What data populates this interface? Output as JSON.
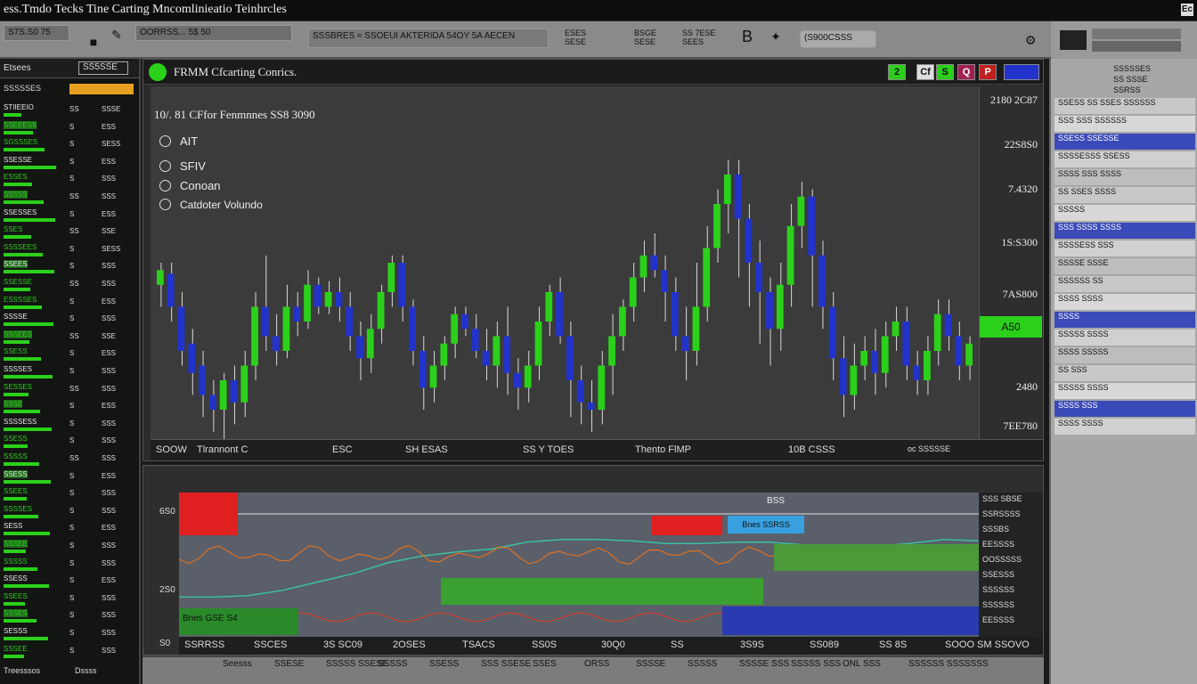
{
  "window": {
    "title": "ess.Tmdo Tecks Tine Carting Mncomlinieatio Teinhrcles",
    "corner_label": "Ec"
  },
  "toolbar": {
    "left_box": "S7S.S0 75",
    "search_box": "OORRSS... 5$ 50",
    "ticker_strip": "SSSBRES ≈ SSOEUI AKTERIDA 54OY  5A AECEN",
    "mid_a": "ESES\nSESE",
    "mid_b": "BSGE\nSESE",
    "mid_c": "SS 7ESE\nSEES",
    "dropdown": "(S900CSSS"
  },
  "left_panel": {
    "header_label": "Etsees",
    "header_box": "SS5SSE",
    "row2_label": "SSSSSES",
    "rows": [
      {
        "name": "STIIEEIO",
        "val": "SS",
        "chg": "SSSE"
      },
      {
        "name": "SSEEESS",
        "val": "S",
        "chg": "ESS"
      },
      {
        "name": "SGSSSES",
        "val": "S",
        "chg": "SESS"
      },
      {
        "name": "SSESSE",
        "val": "S",
        "chg": "ESS"
      },
      {
        "name": "ESSES",
        "val": "S",
        "chg": "SSS"
      },
      {
        "name": "SSSSS",
        "val": "SS",
        "chg": "SSS"
      },
      {
        "name": "SSESSES",
        "val": "S",
        "chg": "ESS"
      },
      {
        "name": "SSES",
        "val": "SS",
        "chg": "SSE"
      },
      {
        "name": "SSSSEES",
        "val": "S",
        "chg": "SESS"
      },
      {
        "name": "SSEES",
        "val": "S",
        "chg": "SSS"
      },
      {
        "name": "SSESSE",
        "val": "SS",
        "chg": "SSS"
      },
      {
        "name": "ESSSSES",
        "val": "S",
        "chg": "ESS"
      },
      {
        "name": "SSSSE",
        "val": "S",
        "chg": "SSS"
      },
      {
        "name": "SSSEES",
        "val": "SS",
        "chg": "SSE"
      },
      {
        "name": "SSESS",
        "val": "S",
        "chg": "ESS"
      },
      {
        "name": "SSSSES",
        "val": "S",
        "chg": "SSS"
      },
      {
        "name": "SESSES",
        "val": "SS",
        "chg": "SSS"
      },
      {
        "name": "SSSE",
        "val": "S",
        "chg": "ESS"
      },
      {
        "name": "SSSSESS",
        "val": "S",
        "chg": "SSS"
      },
      {
        "name": "SSESS",
        "val": "S",
        "chg": "SSS"
      },
      {
        "name": "SSSSS",
        "val": "SS",
        "chg": "SSS"
      },
      {
        "name": "SSESS",
        "val": "S",
        "chg": "ESS"
      },
      {
        "name": "SSEES",
        "val": "S",
        "chg": "SSS"
      },
      {
        "name": "SSSSES",
        "val": "S",
        "chg": "SSS"
      },
      {
        "name": "SESS",
        "val": "S",
        "chg": "ESS"
      },
      {
        "name": "SSSEE",
        "val": "S",
        "chg": "SSS"
      },
      {
        "name": "SSSSS",
        "val": "S",
        "chg": "SSS"
      },
      {
        "name": "SSESS",
        "val": "S",
        "chg": "ESS"
      },
      {
        "name": "SSEES",
        "val": "S",
        "chg": "SSS"
      },
      {
        "name": "SSSES",
        "val": "S",
        "chg": "SSS"
      },
      {
        "name": "SESSS",
        "val": "S",
        "chg": "SSS"
      },
      {
        "name": "SSSEE",
        "val": "S",
        "chg": "SSS"
      }
    ],
    "footer_label": "Treesssos",
    "footer_label2": "Dssss"
  },
  "chart": {
    "header_title": "FRMM Cfcarting Conrics.",
    "summary": "10/. 81 CFfor  Fenmnnes  SS8  3090",
    "legend": [
      "AIT",
      "SFIV",
      "Conoan",
      "Catdoter Volundo"
    ],
    "price_labels": [
      "2180 2C87",
      "22S8S0",
      "7.4320",
      "1S:S300",
      "7AS800",
      "2480",
      "7EE780"
    ],
    "price_highlight": "A50",
    "time_labels": [
      "SOOW",
      "Tlrannont C",
      "ESC",
      "SH ESAS",
      "SS Y  TOES",
      "Thento FlMP",
      "10B CSSS",
      "oc SSSSSE"
    ],
    "header_buttons": [
      "2",
      "Cf",
      "S",
      "Q",
      "P"
    ]
  },
  "chart_data": {
    "type": "candlestick",
    "title": "",
    "y_axis_labels": [
      "2180 2C87",
      "22S8S0",
      "7.4320",
      "1S:S300",
      "7AS800",
      "2480",
      "7EE780"
    ],
    "x_axis_labels": [
      "SOOW",
      "Tlrannont C",
      "ESC",
      "SH ESAS",
      "SS Y  TOES",
      "Thento FlMP",
      "10B CSSS"
    ],
    "series": [
      {
        "name": "AIT",
        "color": "#2bd01a"
      },
      {
        "name": "SFIV",
        "color": "#2233cc"
      }
    ],
    "candles": [
      {
        "o": 270,
        "c": 250,
        "h": 240,
        "l": 300
      },
      {
        "o": 255,
        "c": 300,
        "h": 240,
        "l": 320
      },
      {
        "o": 300,
        "c": 360,
        "h": 280,
        "l": 380
      },
      {
        "o": 350,
        "c": 390,
        "h": 330,
        "l": 420
      },
      {
        "o": 380,
        "c": 420,
        "h": 360,
        "l": 450
      },
      {
        "o": 420,
        "c": 440,
        "h": 400,
        "l": 470
      },
      {
        "o": 440,
        "c": 400,
        "h": 390,
        "l": 480
      },
      {
        "o": 400,
        "c": 430,
        "h": 380,
        "l": 460
      },
      {
        "o": 430,
        "c": 380,
        "h": 360,
        "l": 450
      },
      {
        "o": 380,
        "c": 300,
        "h": 280,
        "l": 400
      },
      {
        "o": 300,
        "c": 340,
        "h": 230,
        "l": 360
      },
      {
        "o": 340,
        "c": 360,
        "h": 310,
        "l": 380
      },
      {
        "o": 360,
        "c": 300,
        "h": 270,
        "l": 370
      },
      {
        "o": 300,
        "c": 320,
        "h": 280,
        "l": 340
      },
      {
        "o": 320,
        "c": 270,
        "h": 250,
        "l": 330
      },
      {
        "o": 270,
        "c": 300,
        "h": 260,
        "l": 310
      },
      {
        "o": 300,
        "c": 280,
        "h": 265,
        "l": 310
      },
      {
        "o": 280,
        "c": 300,
        "h": 260,
        "l": 320
      },
      {
        "o": 300,
        "c": 340,
        "h": 280,
        "l": 360
      },
      {
        "o": 340,
        "c": 370,
        "h": 320,
        "l": 400
      },
      {
        "o": 370,
        "c": 330,
        "h": 310,
        "l": 390
      },
      {
        "o": 330,
        "c": 280,
        "h": 270,
        "l": 350
      },
      {
        "o": 280,
        "c": 240,
        "h": 230,
        "l": 300
      },
      {
        "o": 240,
        "c": 300,
        "h": 230,
        "l": 320
      },
      {
        "o": 300,
        "c": 360,
        "h": 290,
        "l": 380
      },
      {
        "o": 360,
        "c": 410,
        "h": 340,
        "l": 440
      },
      {
        "o": 410,
        "c": 380,
        "h": 360,
        "l": 430
      },
      {
        "o": 380,
        "c": 350,
        "h": 340,
        "l": 400
      },
      {
        "o": 350,
        "c": 310,
        "h": 300,
        "l": 370
      },
      {
        "o": 310,
        "c": 330,
        "h": 300,
        "l": 340
      },
      {
        "o": 330,
        "c": 360,
        "h": 310,
        "l": 370
      },
      {
        "o": 360,
        "c": 380,
        "h": 330,
        "l": 400
      },
      {
        "o": 380,
        "c": 340,
        "h": 320,
        "l": 410
      },
      {
        "o": 340,
        "c": 390,
        "h": 300,
        "l": 420
      },
      {
        "o": 390,
        "c": 410,
        "h": 370,
        "l": 440
      },
      {
        "o": 410,
        "c": 380,
        "h": 360,
        "l": 430
      },
      {
        "o": 380,
        "c": 320,
        "h": 300,
        "l": 400
      },
      {
        "o": 320,
        "c": 280,
        "h": 270,
        "l": 340
      },
      {
        "o": 280,
        "c": 340,
        "h": 260,
        "l": 350
      },
      {
        "o": 340,
        "c": 400,
        "h": 320,
        "l": 450
      },
      {
        "o": 400,
        "c": 430,
        "h": 380,
        "l": 460
      },
      {
        "o": 430,
        "c": 440,
        "h": 400,
        "l": 470
      },
      {
        "o": 440,
        "c": 380,
        "h": 360,
        "l": 460
      },
      {
        "o": 380,
        "c": 340,
        "h": 310,
        "l": 420
      },
      {
        "o": 340,
        "c": 300,
        "h": 290,
        "l": 360
      },
      {
        "o": 300,
        "c": 260,
        "h": 240,
        "l": 320
      },
      {
        "o": 260,
        "c": 230,
        "h": 210,
        "l": 280
      },
      {
        "o": 230,
        "c": 250,
        "h": 200,
        "l": 260
      },
      {
        "o": 250,
        "c": 280,
        "h": 230,
        "l": 320
      },
      {
        "o": 280,
        "c": 340,
        "h": 260,
        "l": 360
      },
      {
        "o": 340,
        "c": 360,
        "h": 300,
        "l": 400
      },
      {
        "o": 360,
        "c": 300,
        "h": 240,
        "l": 380
      },
      {
        "o": 300,
        "c": 220,
        "h": 190,
        "l": 320
      },
      {
        "o": 220,
        "c": 160,
        "h": 140,
        "l": 240
      },
      {
        "o": 160,
        "c": 120,
        "h": 100,
        "l": 200
      },
      {
        "o": 120,
        "c": 180,
        "h": 100,
        "l": 260
      },
      {
        "o": 180,
        "c": 240,
        "h": 160,
        "l": 300
      },
      {
        "o": 240,
        "c": 280,
        "h": 210,
        "l": 350
      },
      {
        "o": 280,
        "c": 330,
        "h": 260,
        "l": 380
      },
      {
        "o": 330,
        "c": 270,
        "h": 240,
        "l": 360
      },
      {
        "o": 270,
        "c": 190,
        "h": 160,
        "l": 300
      },
      {
        "o": 190,
        "c": 150,
        "h": 130,
        "l": 220
      },
      {
        "o": 150,
        "c": 230,
        "h": 140,
        "l": 300
      },
      {
        "o": 230,
        "c": 300,
        "h": 210,
        "l": 330
      },
      {
        "o": 300,
        "c": 370,
        "h": 280,
        "l": 400
      },
      {
        "o": 370,
        "c": 420,
        "h": 340,
        "l": 450
      },
      {
        "o": 420,
        "c": 380,
        "h": 350,
        "l": 440
      },
      {
        "o": 380,
        "c": 360,
        "h": 340,
        "l": 400
      },
      {
        "o": 360,
        "c": 390,
        "h": 330,
        "l": 420
      },
      {
        "o": 390,
        "c": 340,
        "h": 320,
        "l": 410
      },
      {
        "o": 340,
        "c": 320,
        "h": 300,
        "l": 360
      },
      {
        "o": 320,
        "c": 380,
        "h": 300,
        "l": 400
      },
      {
        "o": 380,
        "c": 400,
        "h": 360,
        "l": 420
      },
      {
        "o": 400,
        "c": 360,
        "h": 340,
        "l": 420
      },
      {
        "o": 360,
        "c": 310,
        "h": 290,
        "l": 380
      },
      {
        "o": 310,
        "c": 340,
        "h": 290,
        "l": 360
      },
      {
        "o": 340,
        "c": 380,
        "h": 320,
        "l": 400
      },
      {
        "o": 380,
        "c": 350,
        "h": 340,
        "l": 400
      }
    ]
  },
  "lower": {
    "left_labels": [
      "6S0",
      "2S0",
      "S0"
    ],
    "badge_left": "Bnes GSE  S4",
    "badge_mid": "Bnes SSRSS",
    "badge_top": "BSS",
    "right_labels": [
      "SSS SBSE",
      "SSRSSSS",
      "SSSBS",
      "EESSSS",
      "OOSSSSS",
      "SSESSS",
      "SSSSSS",
      "SSSSSS",
      "EESSSS"
    ],
    "time_labels": [
      "SSRRSS",
      "SSCES",
      "3S SC09",
      "2OSES",
      "TSACS",
      "SS0S",
      "30Q0",
      "SS",
      "3S9S",
      "SS089",
      "SS 8S",
      "SOOO SM SSOVO"
    ],
    "area_values": [
      0.55,
      0.55,
      0.56,
      0.6,
      0.66,
      0.72,
      0.8,
      0.85,
      0.88,
      0.9,
      0.95,
      0.97,
      0.97,
      0.96,
      0.94,
      0.94,
      0.95,
      0.95,
      0.93,
      0.93,
      0.92,
      0.94,
      0.97,
      0.96
    ]
  },
  "right_panel": {
    "header": [
      "SSSSSES",
      "SS SSSE",
      "SSRSS"
    ],
    "rows": [
      "SSESS SS SSES SSSSSS",
      "SSS SSS SSSSSS",
      "SSESS  SSESSE",
      "SSSSESSS  SSESS",
      "SSSS SSS  SSSS",
      "SS SSES  SSSS",
      "SSSSS",
      "SSS SSSS SSSS",
      "SSSSESS  SSS",
      "SSSSE  SSSE",
      "SSSSSS  SS",
      "SSSS SSSS",
      "SSSS",
      "SSSSS  SSSS",
      "SSSS SSSSS",
      "SS SSS",
      "SSSSS  SSSS",
      "SSSS  SSS",
      "SSSS SSSS"
    ]
  },
  "status": {
    "items": [
      "Seesss",
      "SSESE",
      "SSSSS SSESE",
      "SSSSS",
      "SSESS",
      "SSS SSESE",
      "SSES",
      "ORSS",
      "SSSSE",
      "SSSSS",
      "SSSSE SSS",
      "SSSSS SSS"
    ],
    "right_label": "ONL  SSS",
    "right_label2": "SSSSSS SSSSSSS"
  },
  "colors": {
    "bull": "#2bd01a",
    "bear": "#2233cc",
    "accent_red": "#e02020",
    "accent_blue": "#39a0e0"
  }
}
